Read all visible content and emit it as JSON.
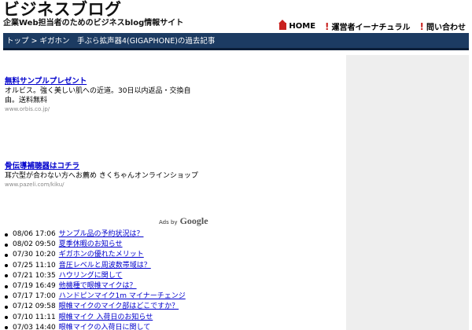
{
  "header": {
    "logo": "ビジネスブログ",
    "tagline": "企業Web担当者のためのビジネスblog情報サイト",
    "nav": [
      {
        "label": "HOME",
        "icon": "home-icon"
      },
      {
        "label": "運営者イーナチュラル",
        "icon": "exclamation-icon"
      },
      {
        "label": "問い合わせ",
        "icon": "exclamation-icon"
      }
    ]
  },
  "breadcrumb": {
    "home": "トップ",
    "separator": ">",
    "current": "ギガホン　手ぶら拡声器4(GIGAPHONE)の過去記事"
  },
  "ads": [
    {
      "title": "無料サンプルプレゼント",
      "line1": "オルビス。強く美しい肌への近道。30日以内返品・交換自",
      "line2": "由。送料無料",
      "url": "www.orbis.co.jp/"
    },
    {
      "title": "骨伝導補聴器はコチラ",
      "line1": "耳穴型が合わない方へお薦め きくちゃんオンラインショップ",
      "line2": "",
      "url": "www.pazeli.com/kiku/"
    }
  ],
  "adsby": {
    "prefix": "Ads by",
    "brand": "Google"
  },
  "posts": [
    {
      "date": "08/06 17:06",
      "title": "サンプル品の予約状況は？"
    },
    {
      "date": "08/02 09:50",
      "title": "夏季休暇のお知らせ"
    },
    {
      "date": "07/30 10:20",
      "title": "ギガホンの優れたメリット"
    },
    {
      "date": "07/25 11:10",
      "title": "音圧レベルと周波数帯域は？"
    },
    {
      "date": "07/21 10:35",
      "title": "ハウリングに関して"
    },
    {
      "date": "07/19 16:49",
      "title": "他機種で眼帷マイクは？"
    },
    {
      "date": "07/17 17:00",
      "title": "ハンドピンマイク1m マイナーチェンジ"
    },
    {
      "date": "07/12 09:58",
      "title": "眼帷マイクのマイク部はどこですか？"
    },
    {
      "date": "07/10 11:11",
      "title": "眼帷マイク 入荷日のお知らせ"
    },
    {
      "date": "07/03 14:40",
      "title": "眼帷マイクの入荷日に関して"
    }
  ],
  "colors": {
    "breadcrumb_bg": "#1c3b62",
    "link": "#0000cc",
    "accent_red": "#c8201e",
    "sidebar_bg": "#eeeeee"
  }
}
